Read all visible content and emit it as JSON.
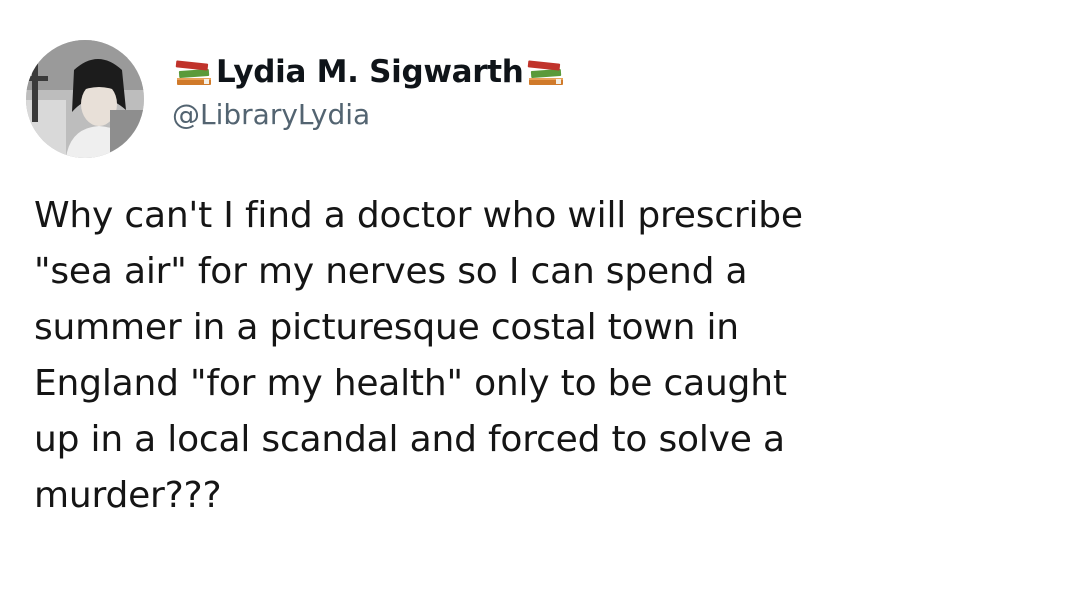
{
  "tweet": {
    "author": {
      "display_name": "Lydia M. Sigwarth",
      "handle": "@LibraryLydia",
      "name_emoji": "books-icon"
    },
    "text_lines": [
      "Why can't I find a doctor who will prescribe",
      "\"sea air\" for my nerves so I can spend a",
      "summer in a picturesque costal town in",
      "England \"for my health\" only to be caught",
      "up in a local scandal and forced to solve a",
      "murder???"
    ]
  },
  "colors": {
    "background": "#ffffff",
    "text": "#151515",
    "handle": "#536471"
  }
}
